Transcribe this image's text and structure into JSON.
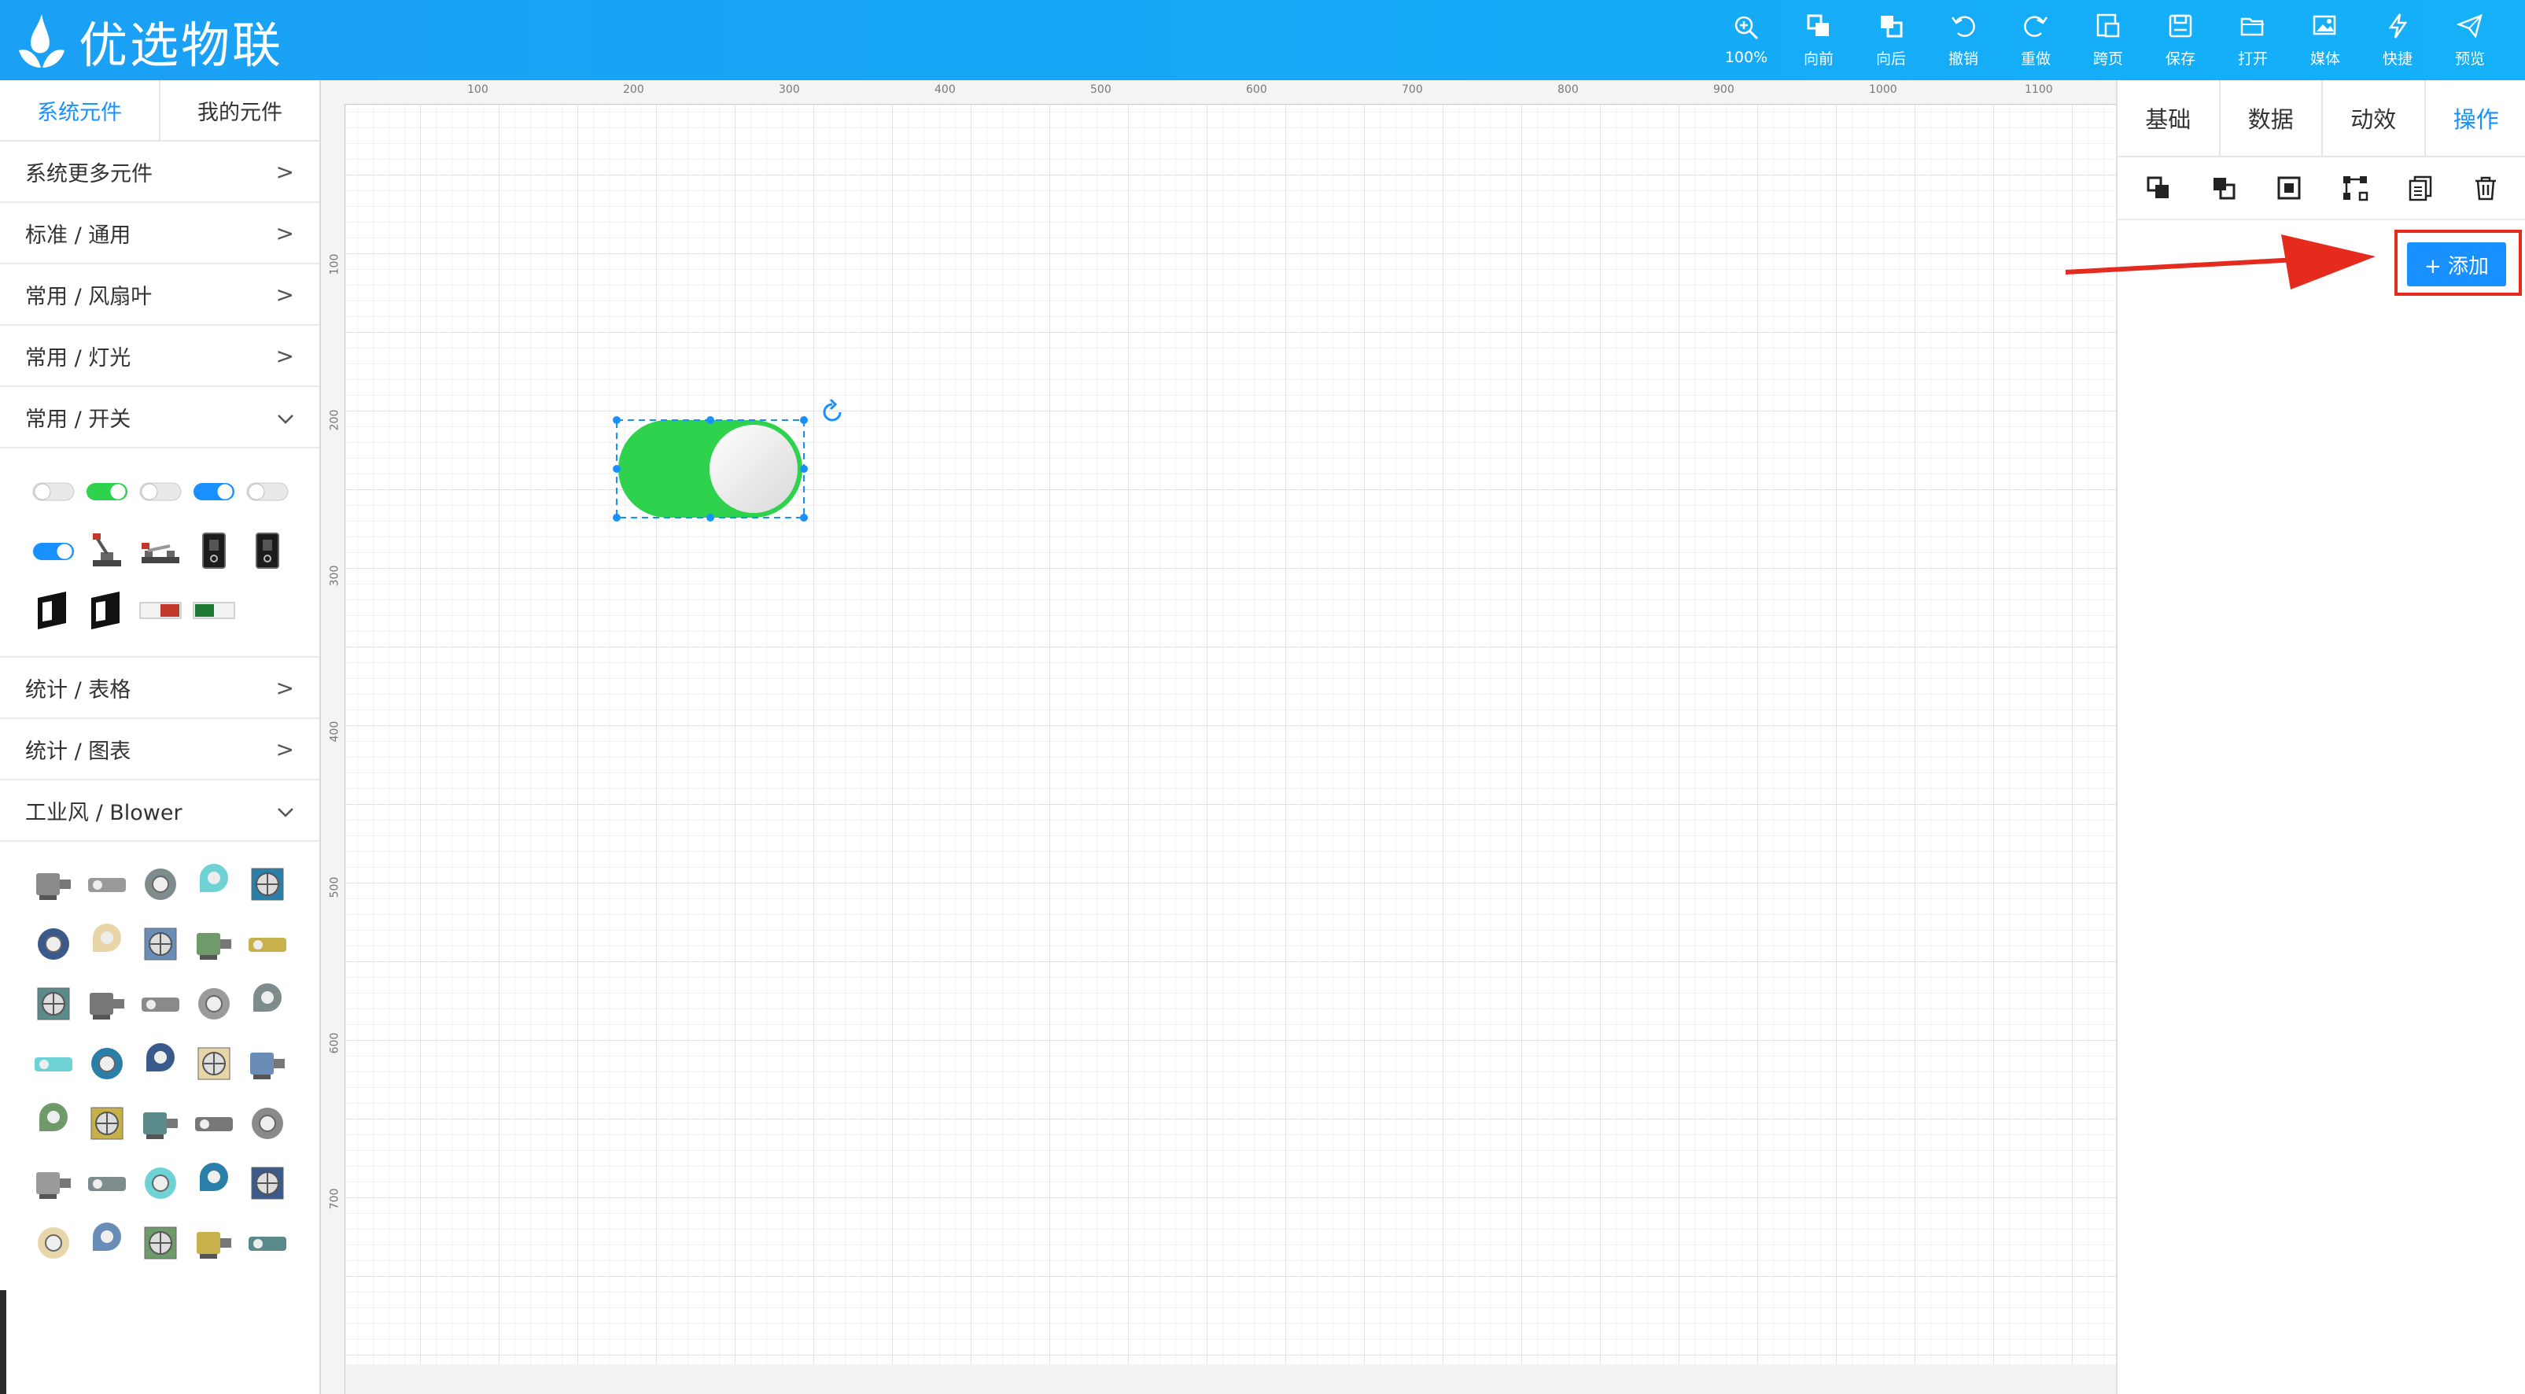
{
  "app": {
    "name": "优选物联"
  },
  "toolbar": [
    {
      "label": "100%",
      "icon": "zoom-in-icon"
    },
    {
      "label": "向前",
      "icon": "bring-forward-icon"
    },
    {
      "label": "向后",
      "icon": "send-backward-icon"
    },
    {
      "label": "撤销",
      "icon": "undo-icon"
    },
    {
      "label": "重做",
      "icon": "redo-icon"
    },
    {
      "label": "跨页",
      "icon": "cross-page-icon"
    },
    {
      "label": "保存",
      "icon": "save-icon"
    },
    {
      "label": "打开",
      "icon": "folder-open-icon"
    },
    {
      "label": "媒体",
      "icon": "media-icon"
    },
    {
      "label": "快捷",
      "icon": "lightning-icon"
    },
    {
      "label": "预览",
      "icon": "send-icon"
    }
  ],
  "left_panel": {
    "tabs": [
      "系统元件",
      "我的元件"
    ],
    "active_tab": "系统元件",
    "categories": [
      {
        "label": "系统更多元件",
        "expanded": false
      },
      {
        "label": "标准 / 通用",
        "expanded": false
      },
      {
        "label": "常用 / 风扇叶",
        "expanded": false
      },
      {
        "label": "常用 / 灯光",
        "expanded": false
      },
      {
        "label": "常用 / 开关",
        "expanded": true
      },
      {
        "label": "统计 / 表格",
        "expanded": false
      },
      {
        "label": "统计 / 图表",
        "expanded": false
      },
      {
        "label": "工业风 / Blower",
        "expanded": true
      }
    ],
    "chevrons": {
      "collapsed": ">",
      "expanded": "v"
    },
    "switch_items": [
      "toggle-off-icon",
      "toggle-green-on-icon",
      "toggle-off-icon",
      "toggle-blue-on-icon",
      "toggle-off-icon",
      "toggle-blue-on-icon",
      "lever-switch-icon",
      "knife-switch-icon",
      "rocker-switch-icon",
      "rocker-switch-icon",
      "wall-switch-icon",
      "wall-switch-icon",
      "off-button-icon",
      "on-button-icon"
    ],
    "blower_item_count": 35
  },
  "canvas": {
    "ruler_top": [
      "100",
      "200",
      "300",
      "400",
      "500",
      "600",
      "700",
      "800",
      "900",
      "1000",
      "1100"
    ],
    "ruler_left": [
      "100",
      "200",
      "300",
      "400",
      "500",
      "600",
      "700"
    ],
    "selected_element": {
      "type": "toggle-switch",
      "state": "on",
      "color": "#2fd24c"
    }
  },
  "right_panel": {
    "tabs": [
      "基础",
      "数据",
      "动效",
      "操作"
    ],
    "active_tab": "操作",
    "actions": [
      "bring-to-front-icon",
      "send-to-back-icon",
      "group-icon",
      "ungroup-icon",
      "copy-icon",
      "delete-icon"
    ],
    "add_button": "+ 添加"
  },
  "colors": {
    "header": "#14a8f7",
    "accent": "#1890ff",
    "highlight": "#e52a1e",
    "toggle_green": "#2fd24c"
  }
}
